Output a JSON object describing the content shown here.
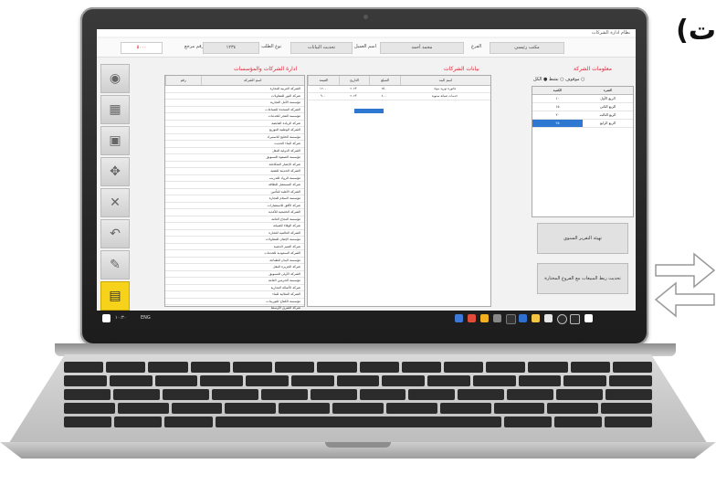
{
  "overlay": {
    "text": "(ت"
  },
  "window": {
    "title": "نظام ادارة الشركات"
  },
  "toolbar": {
    "amount": "٥٠٠٠",
    "fields": [
      {
        "label": "الفرع",
        "value": "مكتب رئيسي"
      },
      {
        "label": "اسم العميل",
        "value": "محمد أحمد"
      },
      {
        "label": "نوع الطلب",
        "value": "تحديث البيانات"
      },
      {
        "label": "رقم مرجع",
        "value": "١٢٣٤"
      }
    ]
  },
  "sidebar": {
    "items": [
      {
        "icon": "disc-icon",
        "glyph": "◉"
      },
      {
        "icon": "map-icon",
        "glyph": "▦"
      },
      {
        "icon": "save-icon",
        "glyph": "▣"
      },
      {
        "icon": "handshake-icon",
        "glyph": "✥"
      },
      {
        "icon": "close-icon",
        "glyph": "✕"
      },
      {
        "icon": "undo-icon",
        "glyph": "↶"
      },
      {
        "icon": "edit-icon",
        "glyph": "✎"
      },
      {
        "icon": "folder-icon",
        "glyph": "▤"
      }
    ]
  },
  "panels": {
    "list_title": "ادارة الشركات والمؤسسات",
    "grid_title": "بيانات الشركات",
    "right_title": "معلومات الشركة"
  },
  "company_list": {
    "headers": [
      "اسم الشركة",
      "رقم"
    ],
    "rows": [
      "الشركة العربية للتجارة",
      "شركة النور للمقاولات",
      "مؤسسة الأمل التجارية",
      "الشركة المتحدة للصناعات",
      "مؤسسة الفجر للخدمات",
      "شركة الريادة القابضة",
      "الشركة الوطنية للتوزيع",
      "مؤسسة الخليج للاستيراد",
      "شركة البناء الحديث",
      "الشركة الدولية للنقل",
      "مؤسسة الصفوة للتسويق",
      "شركة الإعمار المتكاملة",
      "الشركة الحديثة للتقنية",
      "مؤسسة الرواد للتدريب",
      "شركة المستقبل للطاقة",
      "الشركة الأهلية للتأمين",
      "مؤسسة السلام للتجارة",
      "شركة الأفق للاستشارات",
      "الشركة الخليجية للأغذية",
      "مؤسسة النجاح العامة",
      "شركة الوفاء للصيانة",
      "الشركة العالمية للتجارة",
      "مؤسسة الإتقان للمقاولات",
      "شركة التميز الذهبية",
      "الشركة السعودية للخدمات",
      "مؤسسة البيان للطباعة",
      "شركة الجزيرة للنقل",
      "الشركة الأولى للتسويق",
      "مؤسسة الحرمين العامة",
      "شركة الأصالة التجارية",
      "الشركة المثالية للبناء",
      "مؤسسة الكفاح للتوريدات",
      "شركة الشرق الأوسط",
      "الشركة الشاملة للحلول",
      "مؤسسة الإبداع للتصميم",
      "شركة الهدى التجارية"
    ]
  },
  "data_grid": {
    "headers": [
      "اسم البند",
      "المبلغ",
      "التاريخ",
      "القيمة"
    ],
    "rows": [
      [
        "فاتورة توريد مواد",
        "٢٥٠",
        "٢٠٢٣",
        "١٢٠٠"
      ],
      [
        "خدمات صيانة سنوية",
        "٤٠٠",
        "٢٠٢٣",
        "٩٠٠"
      ]
    ]
  },
  "right": {
    "radios": [
      "الكل",
      "نشط",
      "موقوف"
    ],
    "headers": [
      "الفترة",
      "الكمية"
    ],
    "rows": [
      [
        "الربع الأول",
        "١٠"
      ],
      [
        "الربع الثاني",
        "١٥"
      ],
      [
        "الربع الثالث",
        "٢٠"
      ],
      [
        "الربع الرابع",
        "٢٥"
      ]
    ],
    "btn1": "تهيئة التقرير السنوي",
    "btn2": "تحديث ربط المبيعات مع الفروع المختارة"
  },
  "taskbar": {
    "time": "١٠:٣٠",
    "date": "٢٠٢٣/٠٥/٠١",
    "tray": "ENG"
  }
}
